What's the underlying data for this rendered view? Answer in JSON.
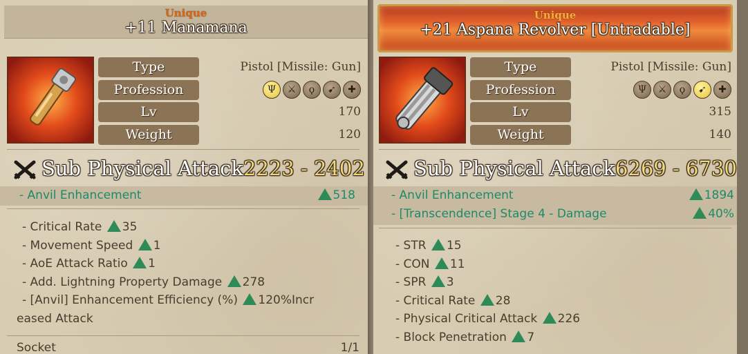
{
  "left": {
    "rarity": "Unique",
    "name": "+11 Manamana",
    "rows": [
      {
        "label": "Type",
        "value": "Pistol [Missile: Gun]"
      },
      {
        "label": "Profession",
        "value": ""
      },
      {
        "label": "Lv",
        "value": "170"
      },
      {
        "label": "Weight",
        "value": "120"
      }
    ],
    "profession_icons": [
      {
        "name": "claw-icon",
        "glyph": "Ψ",
        "active": true
      },
      {
        "name": "sword-icon",
        "glyph": "⚔",
        "active": false
      },
      {
        "name": "staff-icon",
        "glyph": "ϙ",
        "active": false
      },
      {
        "name": "bow-icon",
        "glyph": "➹",
        "active": false
      },
      {
        "name": "cross-icon",
        "glyph": "✚",
        "active": false
      }
    ],
    "attack_label": "Sub Physical Attack",
    "attack_range": "2223 - 2402",
    "enhancements": [
      {
        "label": "- Anvil Enhancement",
        "value": "518"
      }
    ],
    "bonuses": [
      {
        "text": "- Critical Rate ",
        "value": "35",
        "suffix": ""
      },
      {
        "text": "- Movement Speed ",
        "value": "1",
        "suffix": ""
      },
      {
        "text": "- AoE Attack Ratio ",
        "value": "1",
        "suffix": ""
      },
      {
        "text": "- Add. Lightning Property Damage ",
        "value": "278",
        "suffix": ""
      },
      {
        "text": "- [Anvil] Enhancement Efficiency (%) ",
        "value": "120%Incr",
        "suffix": "eased Attack"
      }
    ],
    "socket_label": "Socket",
    "socket_value": "1/1"
  },
  "right": {
    "rarity": "Unique",
    "name": "+21 Aspana Revolver [Untradable]",
    "rows": [
      {
        "label": "Type",
        "value": "Pistol [Missile: Gun]"
      },
      {
        "label": "Profession",
        "value": ""
      },
      {
        "label": "Lv",
        "value": "315"
      },
      {
        "label": "Weight",
        "value": "140"
      }
    ],
    "profession_icons": [
      {
        "name": "claw-icon",
        "glyph": "Ψ",
        "active": false
      },
      {
        "name": "sword-icon",
        "glyph": "⚔",
        "active": false
      },
      {
        "name": "staff-icon",
        "glyph": "ϙ",
        "active": false
      },
      {
        "name": "bow-icon",
        "glyph": "➹",
        "active": true
      },
      {
        "name": "cross-icon",
        "glyph": "✚",
        "active": false
      }
    ],
    "attack_label": "Sub Physical Attack",
    "attack_range": "6269 - 6730",
    "enhancements": [
      {
        "label": "- Anvil Enhancement",
        "value": "1894"
      },
      {
        "label": "- [Transcendence] Stage 4 - Damage",
        "value": "40%"
      }
    ],
    "bonuses": [
      {
        "text": "- STR ",
        "value": "15",
        "suffix": ""
      },
      {
        "text": "- CON ",
        "value": "11",
        "suffix": ""
      },
      {
        "text": "- SPR ",
        "value": "3",
        "suffix": ""
      },
      {
        "text": "- Critical Rate ",
        "value": "28",
        "suffix": ""
      },
      {
        "text": "- Physical Critical Attack ",
        "value": "226",
        "suffix": ""
      },
      {
        "text": "- Block Penetration ",
        "value": "7",
        "suffix": ""
      }
    ]
  },
  "colors": {
    "enhancement_green": "#1d8a6a",
    "rarity_orange": "#d2691e",
    "attack_gold": "#f1d67a"
  }
}
